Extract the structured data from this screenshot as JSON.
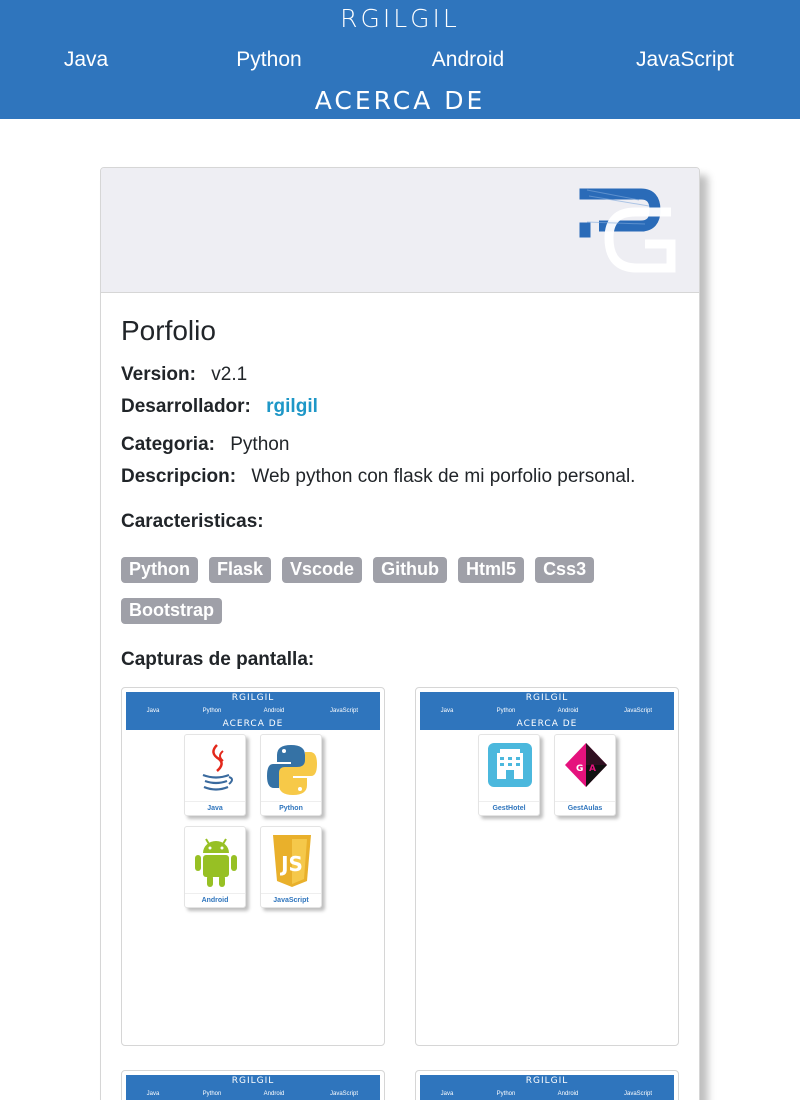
{
  "header": {
    "brand": "RGILGIL",
    "nav": [
      "Java",
      "Python",
      "Android",
      "JavaScript"
    ],
    "about": "ACERCA DE"
  },
  "project": {
    "title": "Porfolio",
    "version_label": "Version:",
    "version": "v2.1",
    "developer_label": "Desarrollador:",
    "developer": "rgilgil",
    "category_label": "Categoria:",
    "category": "Python",
    "description_label": "Descripcion:",
    "description": "Web python con flask de mi porfolio personal.",
    "features_label": "Caracteristicas:",
    "features": [
      "Python",
      "Flask",
      "Vscode",
      "Github",
      "Html5",
      "Css3",
      "Bootstrap"
    ],
    "screenshots_label": "Capturas de pantalla:"
  },
  "screenshots": [
    {
      "tiles": [
        "Java",
        "Python",
        "Android",
        "JavaScript"
      ]
    },
    {
      "tiles": [
        "GestHotel",
        "GestAulas"
      ]
    }
  ],
  "colors": {
    "header_bg": "#2f75bd",
    "tag_bg": "#9fa0a8",
    "link": "#1e97c7"
  }
}
